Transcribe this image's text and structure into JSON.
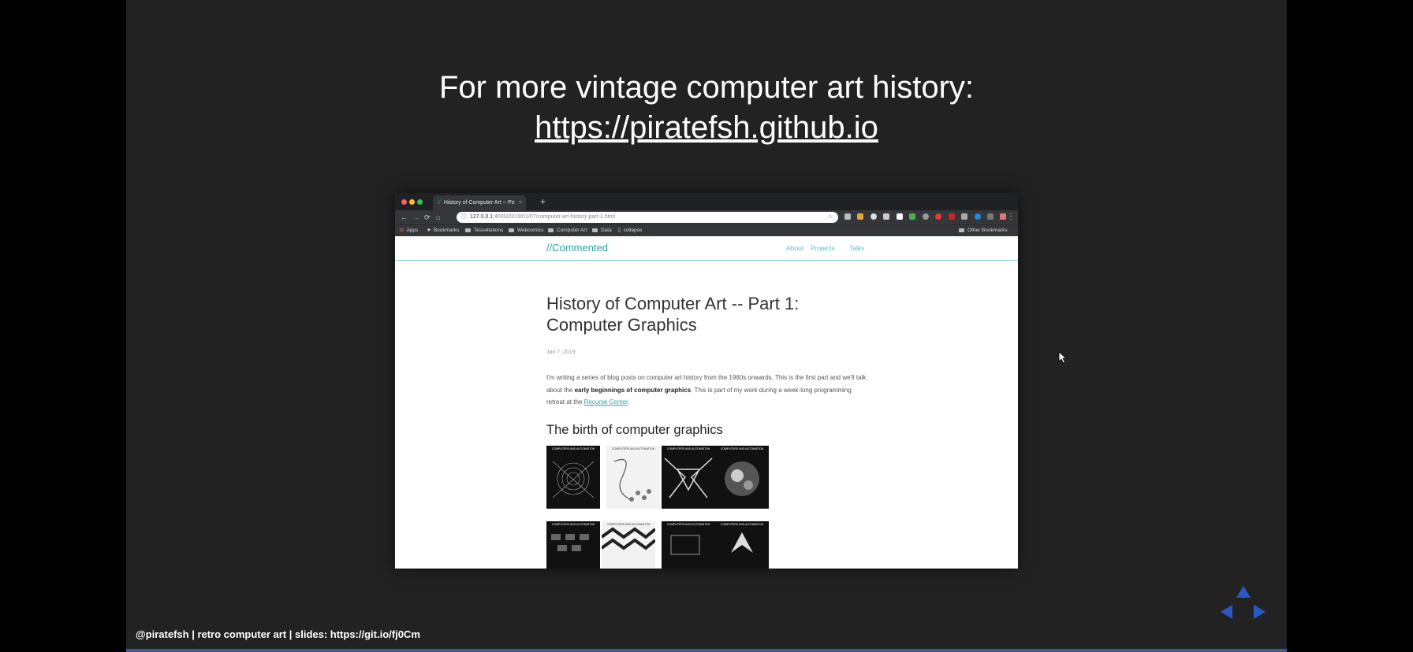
{
  "slide": {
    "title": "For more vintage computer art history:",
    "link": "https://piratefsh.github.io",
    "footer": "@piratefsh | retro computer art | slides: https://git.io/fj0Cm"
  },
  "colors": {
    "slide_bg": "#222222",
    "accent_teal": "#2aa3a6",
    "nav_arrow_blue": "#2b59c3",
    "footer_line": "#3d5a99"
  },
  "browser": {
    "tab_title": "History of Computer Art -- Pe",
    "tab_icon": "//",
    "tab_close": "×",
    "new_tab": "+",
    "url_host": "127.0.0.1",
    "url_path": ":4000/2019/01/07/computer-art-history-part-1.html",
    "bookmarks": {
      "apps": "Apps",
      "bookmarks": "Bookmarks",
      "tessellations": "Tessellations",
      "webcomics": "Webcomics",
      "computer_art": "Computer Art",
      "data": "Data",
      "collapse": "collapse",
      "other": "Other Bookmarks"
    }
  },
  "site": {
    "logo": "//Commented",
    "nav": [
      "About",
      "Projects",
      "Talks"
    ]
  },
  "post": {
    "title": "History of Computer Art -- Part 1: Computer Graphics",
    "date": "Jan 7, 2019",
    "intro_1": "I'm writing a series of blog posts on computer art history from the 1960s onwards. This is the first part and we'll talk about the ",
    "intro_bold": "early beginnings of computer graphics",
    "intro_2": ". This is part of my work during a week-long programming retreat at the ",
    "intro_link": "Recurse Center",
    "intro_3": ".",
    "section_heading": "The birth of computer graphics",
    "thumbnail_caption": "COMPUTERS AND AUTOMATION"
  }
}
